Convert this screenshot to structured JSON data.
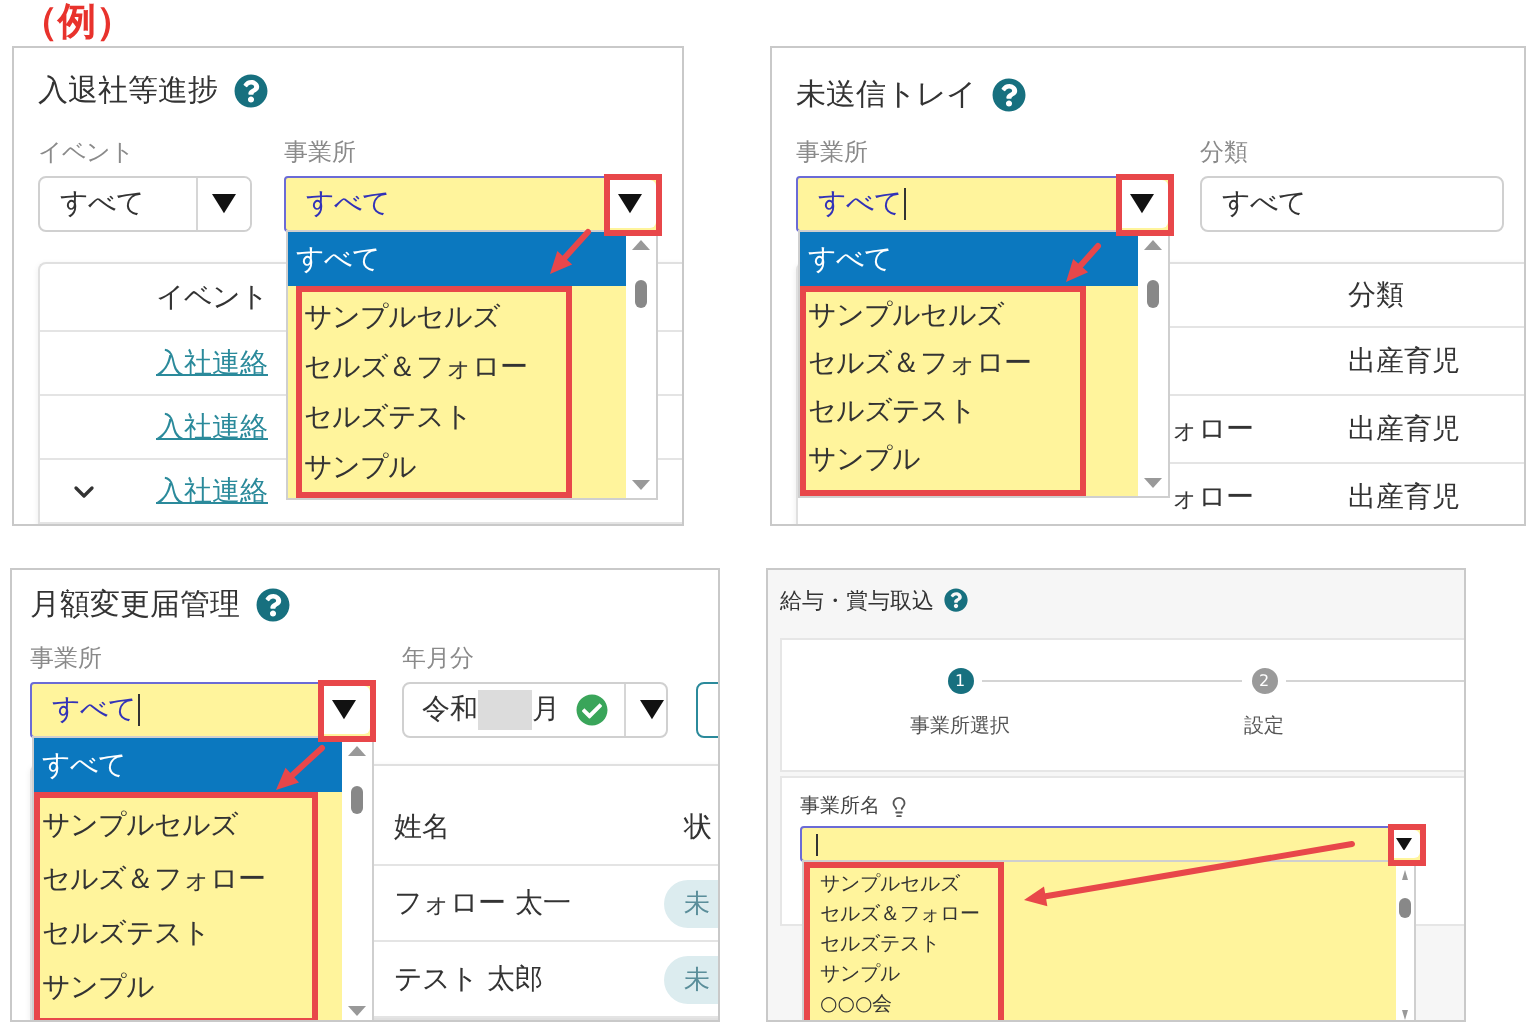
{
  "heading": "（例）",
  "panels": [
    {
      "kind": "event-progress",
      "title": "入退社等進捗",
      "filters": [
        {
          "kind": "select",
          "label": "イベント",
          "value": "すべて",
          "highlighted": false,
          "cursor": false,
          "toggle": true
        },
        {
          "kind": "select",
          "label": "事業所",
          "value": "すべて",
          "highlighted": true,
          "cursor": false,
          "toggle": true,
          "callout": true,
          "options": [
            {
              "label": "すべて",
              "selected": true
            },
            {
              "label": "サンプルセルズ",
              "selected": false
            },
            {
              "label": "セルズ＆フォロー",
              "selected": false
            },
            {
              "label": "セルズテスト",
              "selected": false
            },
            {
              "label": "サンプル",
              "selected": false
            }
          ]
        }
      ],
      "table": {
        "columns": [
          "イベント"
        ],
        "rows": [
          {
            "expander": false,
            "event": "入社連絡"
          },
          {
            "expander": false,
            "event": "入社連絡"
          },
          {
            "expander": true,
            "event": "入社連絡"
          }
        ]
      }
    },
    {
      "kind": "unsent-tray",
      "title": "未送信トレイ",
      "filters": [
        {
          "kind": "select",
          "label": "事業所",
          "value": "すべて",
          "highlighted": true,
          "cursor": true,
          "toggle": true,
          "callout": true,
          "options": [
            {
              "label": "すべて",
              "selected": true
            },
            {
              "label": "サンプルセルズ",
              "selected": false
            },
            {
              "label": "セルズ＆フォロー",
              "selected": false
            },
            {
              "label": "セルズテスト",
              "selected": false
            },
            {
              "label": "サンプル",
              "selected": false
            }
          ]
        },
        {
          "kind": "select",
          "label": "分類",
          "value": "すべて",
          "highlighted": false,
          "cursor": false,
          "toggle": false
        }
      ],
      "table": {
        "columns": [
          "分類"
        ],
        "rows": [
          {
            "category": "出産育児"
          },
          {
            "column_1": "ォロー",
            "category": "出産育児"
          },
          {
            "column_1": "ォロー",
            "category": "出産育児"
          }
        ]
      }
    },
    {
      "kind": "monthly-change",
      "title": "月額変更届管理",
      "filters": [
        {
          "kind": "select",
          "label": "事業所",
          "value": "すべて",
          "highlighted": true,
          "cursor": true,
          "toggle": true,
          "callout": true,
          "options": [
            {
              "label": "すべて",
              "selected": true
            },
            {
              "label": "サンプルセルズ",
              "selected": false
            },
            {
              "label": "セルズ＆フォロー",
              "selected": false
            },
            {
              "label": "セルズテスト",
              "selected": false
            },
            {
              "label": "サンプル",
              "selected": false
            }
          ]
        },
        {
          "kind": "era-month",
          "label": "年月分",
          "era": "令和",
          "suffix": "月",
          "valid": true
        }
      ],
      "table": {
        "columns": [
          "姓名",
          "状"
        ],
        "rows": [
          {
            "name": "フォロー 太一",
            "status": "未"
          },
          {
            "name": "テスト 太郎",
            "status": "未"
          }
        ]
      }
    },
    {
      "kind": "import-wizard",
      "title": "給与・賞与取込",
      "steps": [
        {
          "number": "1",
          "label": "事業所選択",
          "active": true
        },
        {
          "number": "2",
          "label": "設定",
          "active": false
        }
      ],
      "field": {
        "label": "事業所名",
        "highlighted": true,
        "cursor": true,
        "toggle": true,
        "callout": true,
        "options": [
          {
            "label": "サンプルセルズ",
            "selected": false
          },
          {
            "label": "セルズ＆フォロー",
            "selected": false
          },
          {
            "label": "セルズテスト",
            "selected": false
          },
          {
            "label": "サンプル",
            "selected": false
          },
          {
            "label": "○○○会",
            "selected": false
          }
        ]
      }
    }
  ]
}
